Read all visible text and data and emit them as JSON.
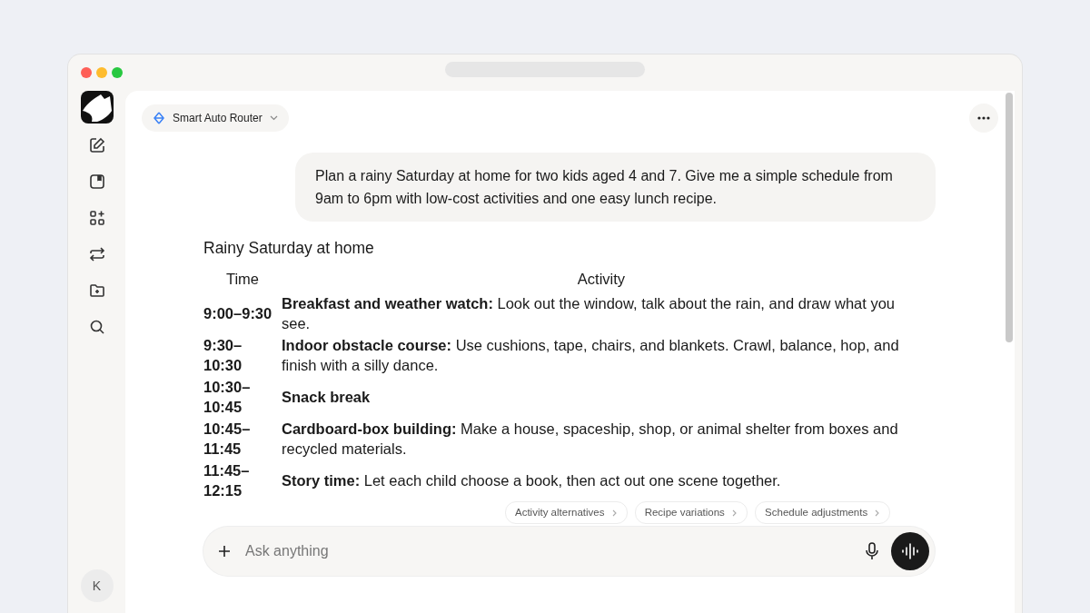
{
  "model_selector": {
    "label": "Smart Auto Router"
  },
  "sidebar": {
    "avatar": "K"
  },
  "user_message": "Plan a rainy Saturday at home for two kids aged 4 and 7. Give me a simple schedule from 9am to 6pm with low-cost activities and one easy lunch recipe.",
  "response": {
    "title": "Rainy Saturday at home",
    "table": {
      "columns": [
        "Time",
        "Activity"
      ],
      "rows": [
        {
          "time": "9:00–9:30",
          "activity": "**Breakfast and weather watch:** Look out the window, talk about the rain, and draw what you see."
        },
        {
          "time": "9:30–10:30",
          "activity": "**Indoor obstacle course:** Use cushions, tape, chairs, and blankets. Crawl, balance, hop, and finish with a silly dance."
        },
        {
          "time": "10:30–10:45",
          "activity": "**Snack break**"
        },
        {
          "time": "10:45–11:45",
          "activity": "**Cardboard-box building:** Make a house, spaceship, shop, or animal shelter from boxes and recycled materials."
        },
        {
          "time": "11:45–12:15",
          "activity": "**Story time:** Let each child choose a book, then act out one scene together."
        }
      ]
    }
  },
  "suggestions": [
    "Activity alternatives",
    "Recipe variations",
    "Schedule adjustments"
  ],
  "composer": {
    "placeholder": "Ask anything"
  }
}
